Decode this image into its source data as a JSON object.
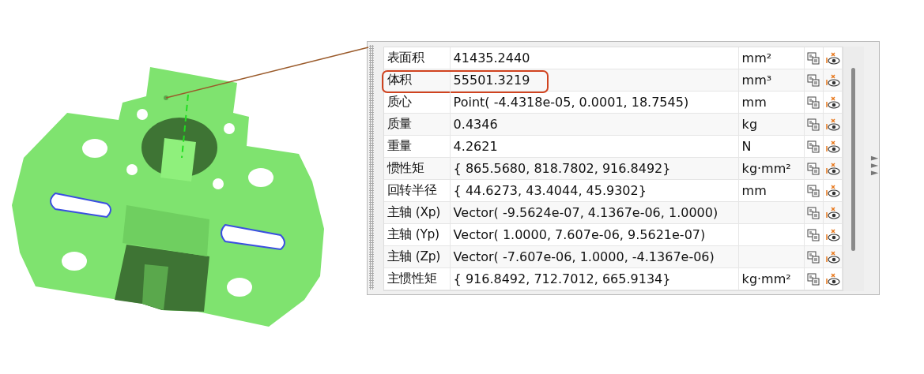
{
  "properties": [
    {
      "label": "表面积",
      "value": "41435.2440",
      "unit": "mm²",
      "highlighted": false
    },
    {
      "label": "体积",
      "value": "55501.3219",
      "unit": "mm³",
      "highlighted": true
    },
    {
      "label": "质心",
      "value": "Point( -4.4318e-05, 0.0001, 18.7545)",
      "unit": "mm",
      "highlighted": false
    },
    {
      "label": "质量",
      "value": "0.4346",
      "unit": "kg",
      "highlighted": false
    },
    {
      "label": "重量",
      "value": "4.2621",
      "unit": "N",
      "highlighted": false
    },
    {
      "label": "惯性矩",
      "value": "{ 865.5680, 818.7802, 916.8492}",
      "unit": "kg·mm²",
      "highlighted": false
    },
    {
      "label": "回转半径",
      "value": "{ 44.6273, 43.4044, 45.9302}",
      "unit": "mm",
      "highlighted": false
    },
    {
      "label": "主轴 (Xp)",
      "value": "Vector( -9.5624e-07, 4.1367e-06, 1.0000)",
      "highlighted": false
    },
    {
      "label": "主轴 (Yp)",
      "value": "Vector( 1.0000, 7.607e-06, 9.5621e-07)",
      "highlighted": false
    },
    {
      "label": "主轴 (Zp)",
      "value": "Vector( -7.607e-06, 1.0000, -4.1367e-06)",
      "highlighted": false
    },
    {
      "label": "主惯性矩",
      "value": "{ 916.8492, 712.7012, 665.9134}",
      "unit": "kg·mm²",
      "highlighted": false
    }
  ]
}
